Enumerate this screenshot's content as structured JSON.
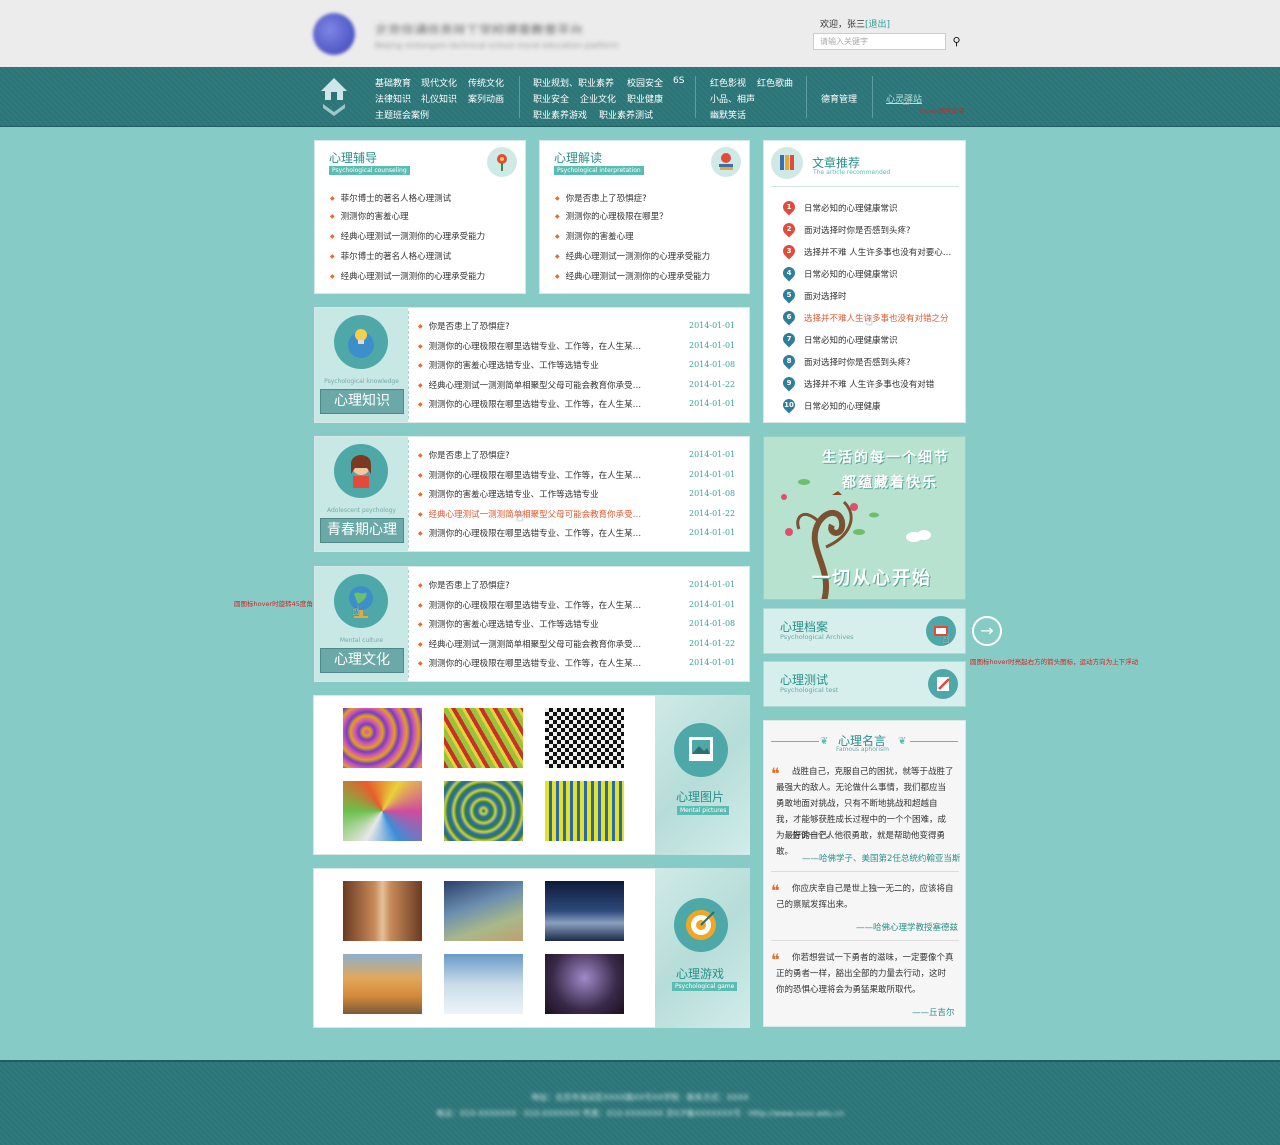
{
  "header": {
    "site_title": "北京信通信息技工学校德育教育平台",
    "site_subtitle": "Beijing xintongxin technical school moral education platform",
    "welcome": "欢迎，张三",
    "logout": "[退出]",
    "search_placeholder": "请输入关键字"
  },
  "nav": {
    "group1": [
      "基础教育",
      "现代文化",
      "传统文化",
      "法律知识",
      "礼仪知识",
      "案列动画",
      "主题班会案例"
    ],
    "group2": [
      "职业规划、职业素养",
      "校园安全",
      "6S",
      "职业安全",
      "企业文化",
      "职业健康",
      "职业素养游戏",
      "职业素养测试"
    ],
    "group3": [
      "红色影视",
      "红色歌曲",
      "小品、相声",
      "幽默笑话"
    ],
    "group4": [
      "德育管理"
    ],
    "group5": [
      "心灵驿站"
    ],
    "hover_note": "hover颜色加深"
  },
  "counseling": {
    "title": "心理辅导",
    "tag": "Psychological counseling",
    "items": [
      "菲尔博士的著名人格心理测试",
      "测测你的害羞心理",
      "经典心理测试一测测你的心理承受能力",
      "菲尔博士的著名人格心理测试",
      "经典心理测试一测测你的心理承受能力"
    ]
  },
  "interpretation": {
    "title": "心理解读",
    "tag": "Psychological interpretation",
    "items": [
      "你是否患上了恐惧症?",
      "测测你的心理极限在哪里？",
      "测测你的害羞心理",
      "经典心理测试一测测你的心理承受能力",
      "经典心理测试一测测你的心理承受能力"
    ]
  },
  "articles": {
    "title": "文章推荐",
    "tag": "The article recommended",
    "items": [
      "日常必知的心理健康常识",
      "面对选择时你是否感到头疼?",
      "选择并不难 人生许多事也没有对要心…",
      "日常必知的心理健康常识",
      "面对选择时",
      "选择并不难人生许多事也没有对错之分",
      "日常必知的心理健康常识",
      "面对选择时你是否感到头疼?",
      "选择并不难 人生许多事也没有对错",
      "日常必知的心理健康"
    ],
    "ranks": [
      "1",
      "2",
      "3",
      "4",
      "5",
      "6",
      "7",
      "8",
      "9",
      "10"
    ]
  },
  "sections": [
    {
      "en": "Psychological knowledge",
      "title": "心理知识",
      "rows": [
        {
          "text": "你是否患上了恐惧症?",
          "date": "2014-01-01"
        },
        {
          "text": "测测你的心理极限在哪里选错专业、工作等，在人生某…",
          "date": "2014-01-01"
        },
        {
          "text": "测测你的害羞心理选错专业、工作等选错专业",
          "date": "2014-01-08"
        },
        {
          "text": "经典心理测试一测测简单相聚型父母可能会教育你承受…",
          "date": "2014-01-22"
        },
        {
          "text": "测测你的心理极限在哪里选错专业、工作等，在人生某…",
          "date": "2014-01-01"
        }
      ]
    },
    {
      "en": "Adolescent psychology",
      "title": "青春期心理",
      "rows": [
        {
          "text": "你是否患上了恐惧症?",
          "date": "2014-01-01"
        },
        {
          "text": "测测你的心理极限在哪里选错专业、工作等，在人生某…",
          "date": "2014-01-01"
        },
        {
          "text": "测测你的害羞心理选错专业、工作等选错专业",
          "date": "2014-01-08"
        },
        {
          "text": "经典心理测试一测测简单相聚型父母可能会教育你承受…",
          "date": "2014-01-22"
        },
        {
          "text": "测测你的心理极限在哪里选错专业、工作等，在人生某…",
          "date": "2014-01-01"
        }
      ]
    },
    {
      "en": "Mental culture",
      "title": "心理文化",
      "rows": [
        {
          "text": "你是否患上了恐惧症?",
          "date": "2014-01-01"
        },
        {
          "text": "测测你的心理极限在哪里选错专业、工作等，在人生某…",
          "date": "2014-01-01"
        },
        {
          "text": "测测你的害羞心理选错专业、工作等选错专业",
          "date": "2014-01-08"
        },
        {
          "text": "经典心理测试一测测简单相聚型父母可能会教育你承受…",
          "date": "2014-01-22"
        },
        {
          "text": "测测你的心理极限在哪里选错专业、工作等，在人生某…",
          "date": "2014-01-01"
        }
      ]
    }
  ],
  "rotate_note": "圆图标hover时旋转45度角",
  "pictures": {
    "title": "心理图片",
    "tag": "Mental pictures"
  },
  "games": {
    "title": "心理游戏",
    "tag": "Psychological game"
  },
  "banner": {
    "line1": "生活的每一个细节",
    "line2": "都蕴藏着快乐",
    "line3": "一切从心开始"
  },
  "archives": {
    "title": "心理档案",
    "tag": "Psychological Archives"
  },
  "test": {
    "title": "心理测试",
    "tag": "Psychological test"
  },
  "arrow_note": "圆图标hover时亮起右方的箭头图标，运动方向为上下浮动",
  "aphorism": {
    "title": "心理名言",
    "tag": "Famous aphorism",
    "quotes": [
      {
        "text": "战胜自己，克服自己的困扰，就等于战胜了最强大的敌人。无论做什么事情，我们都应当勇敢地面对挑战，只有不断地挑战和超越自我，才能够获胜成长过程中的一个个困难，成为最好的自己。",
        "text2": "告诉一个人他很勇敢，就是帮助他变得勇敢。",
        "author": "——哈佛学子、美国第2任总统约翰亚当斯"
      },
      {
        "text": "你应庆幸自己是世上独一无二的，应该将自己的禀赋发挥出来。",
        "author": "——哈佛心理学教授塞德兹"
      },
      {
        "text": "你若想尝试一下勇者的滋味，一定要像个真正的勇者一样，豁出全部的力量去行动，这时你的恐惧心理将会为勇猛果敢所取代。",
        "author": "——丘吉尔"
      }
    ]
  },
  "footer": {
    "line1": "地址：北京市海淀区XXXX路XX号XX学院 · 联系方式：XXXX",
    "line2": "电话：010-XXXXXXX · 010-XXXXXXX 传真：010-XXXXXXX 京ICP备XXXXXXX号 · Http://www.xxxx.edu.cn"
  },
  "colors": {
    "teal": "#86cbc6",
    "nav": "#2d7477",
    "accent": "#2a8f8a",
    "orange": "#e66c2c"
  }
}
